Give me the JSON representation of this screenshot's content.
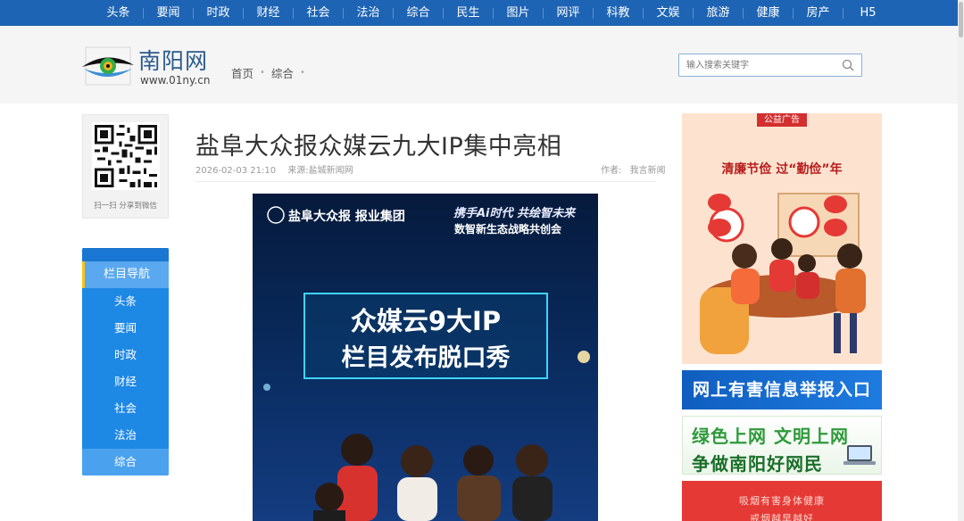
{
  "topnav": {
    "items": [
      "头条",
      "要闻",
      "时政",
      "财经",
      "社会",
      "法治",
      "综合",
      "民生",
      "图片",
      "网评",
      "科教",
      "文娱",
      "旅游",
      "健康",
      "房产",
      "H5"
    ]
  },
  "header": {
    "logo_name": "南阳网",
    "logo_url": "www.01ny.cn",
    "breadcrumb": [
      "首页",
      "综合"
    ],
    "search_placeholder": "输入搜索关键字"
  },
  "sidebar": {
    "qr_caption": "扫一扫 分享到微信",
    "nav_title": "栏目导航",
    "nav_items": [
      "头条",
      "要闻",
      "时政",
      "财经",
      "社会",
      "法治",
      "综合"
    ]
  },
  "article": {
    "title": "盐阜大众报众媒云九大IP集中亮相",
    "datetime": "2026-02-03 21:10",
    "source": "来源:盐城新闻网",
    "author_label": "作者:",
    "author": "我言新闻",
    "poster": {
      "org": "盐阜大众报 报业集团",
      "slogan1": "携手Ai时代 共绘智未来",
      "slogan2": "数智新生态战略共创会",
      "headline1": "众媒云9大IP",
      "headline2": "栏目发布脱口秀"
    }
  },
  "ads": {
    "badge": "公益广告",
    "slogan": "清廉节俭 过“勤俭”年",
    "report": "网上有害信息举报入口",
    "green_line1": "绿色上网 文明上网",
    "green_line2": "争做南阳好网民",
    "smoke_line1": "吸烟有害身体健康",
    "smoke_line2": "戒烟越早越好"
  },
  "colors": {
    "nav_blue": "#1e64b4",
    "sidebar_blue": "#1e88e5",
    "header_bg": "#f5f5f5",
    "accent_red": "#d32f2f"
  }
}
